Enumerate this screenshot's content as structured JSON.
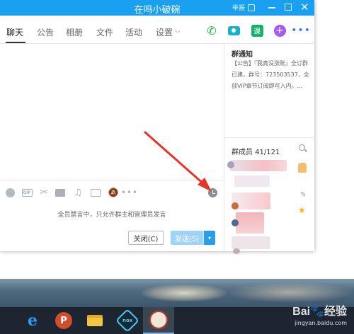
{
  "window": {
    "title": "在吗小破碗",
    "report_label": "举报",
    "close_glyph": "✕"
  },
  "tabs": [
    {
      "label": "聊天",
      "active": true
    },
    {
      "label": "公告",
      "active": false
    },
    {
      "label": "相册",
      "active": false
    },
    {
      "label": "文件",
      "active": false
    },
    {
      "label": "活动",
      "active": false
    },
    {
      "label": "设置",
      "active": false
    }
  ],
  "tab_chevron": "﹀",
  "actions": {
    "phone_icon": "phone-icon",
    "video_icon": "video-icon",
    "class_label": "课",
    "plus_label": "+",
    "more_label": "•••"
  },
  "toolbar": {
    "gif_label": "GIF",
    "more_label": "•••"
  },
  "mute_notice": "全员禁言中，只允许群主和管理员发言",
  "buttons": {
    "close_label": "关闭(C)",
    "send_label": "发送(S)",
    "send_options_label": "▾"
  },
  "group_notice": {
    "title": "群通知",
    "text": "【公告】『我真没涨账』全订群已建，群号：723503537，全部VIP章节订阅即可入内。..."
  },
  "members": {
    "title": "群成员 41/121"
  },
  "taskbar": {
    "ppt_label": "P",
    "nox_label": "nox"
  },
  "watermark": {
    "logo": "Bai🐾经验",
    "url": "jingyan.baidu.com"
  },
  "colors": {
    "titlebar": "#1aa0f0",
    "send_button": "#9fd3f7",
    "annotation_arrow": "#e8332b"
  }
}
